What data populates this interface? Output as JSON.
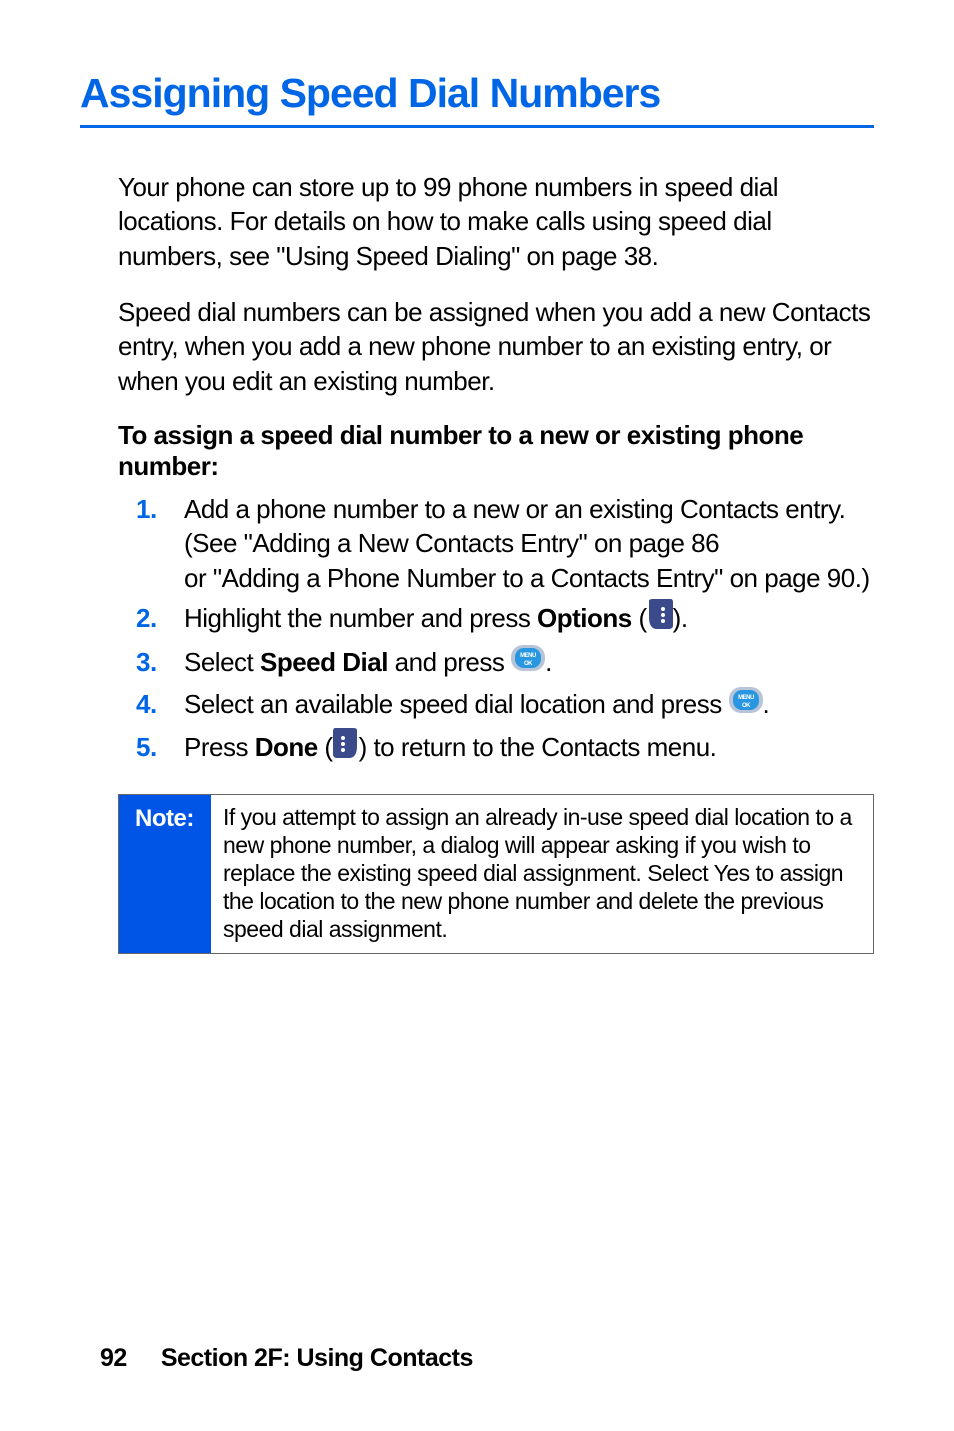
{
  "title": "Assigning Speed Dial Numbers",
  "para1": "Your phone can store up to 99 phone numbers in speed dial locations. For details on how to make calls using speed dial numbers, see \"Using Speed Dialing\" on page 38.",
  "para2": "Speed dial numbers can be assigned when you add a new Contacts entry, when you add a new phone number to an existing entry, or when you edit an existing number.",
  "subhead": "To assign a speed dial number to a new or existing phone number:",
  "steps": {
    "s1_a": "Add a phone number to a new or an existing Contacts entry. (See \"Adding a New Contacts Entry\" on page 86",
    "s1_b": "or \"Adding a Phone Number to a Contacts Entry\" on page 90.)",
    "s2_a": "Highlight the number and press ",
    "s2_bold": "Options",
    "s2_b": " (",
    "s2_c": ").",
    "s3_a": "Select ",
    "s3_bold": "Speed Dial",
    "s3_b": " and press ",
    "s3_c": ".",
    "s4_a": "Select an available speed dial location and press ",
    "s4_b": ".",
    "s5_a": "Press ",
    "s5_bold": "Done",
    "s5_b": " (",
    "s5_c": ") to return to the Contacts menu."
  },
  "note_label": "Note:",
  "note_text": "If you attempt to assign an already in-use speed dial location to a new phone number, a dialog will appear asking if you wish to replace the existing speed dial assignment. Select Yes to assign the location to the new phone number and delete the previous speed dial assignment.",
  "footer_page": "92",
  "footer_section": "Section 2F: Using Contacts",
  "icons": {
    "softkey_right": "softkey-right-icon",
    "menu_ok": "menu-ok-icon",
    "softkey_left": "softkey-left-icon"
  }
}
